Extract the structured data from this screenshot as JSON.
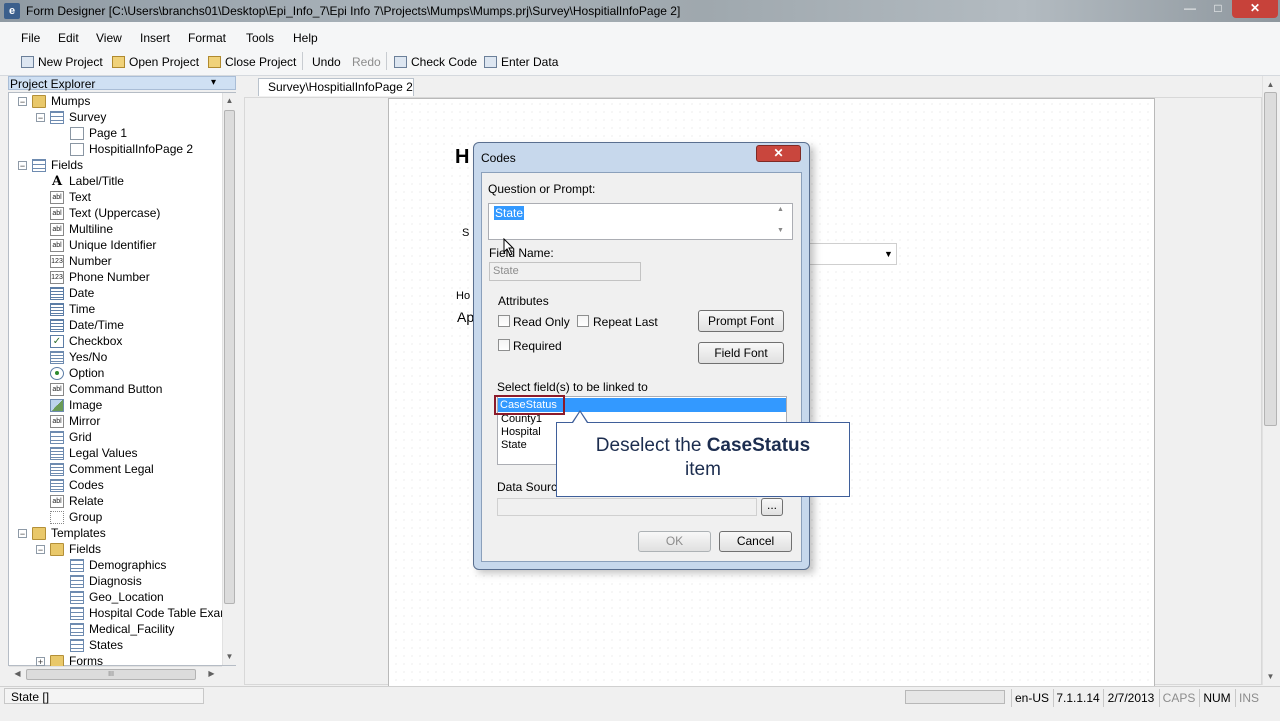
{
  "window": {
    "title": "Form Designer  [C:\\Users\\branchs01\\Desktop\\Epi_Info_7\\Epi Info 7\\Projects\\Mumps\\Mumps.prj\\Survey\\HospitialInfoPage 2]",
    "app_icon": "e",
    "minimize": "—",
    "maximize": "□",
    "close": "✕"
  },
  "menu": [
    "File",
    "Edit",
    "View",
    "Insert",
    "Format",
    "Tools",
    "Help"
  ],
  "toolbar": {
    "new_project": "New Project",
    "open_project": "Open Project",
    "close_project": "Close Project",
    "undo": "Undo",
    "redo": "Redo",
    "check_code": "Check Code",
    "enter_data": "Enter Data"
  },
  "explorer": {
    "title": "Project Explorer",
    "pin": "▾",
    "tree": [
      {
        "label": "Mumps",
        "icon": "folder-icon"
      },
      {
        "label": "Survey",
        "icon": "form-icon"
      },
      {
        "label": "Page 1",
        "icon": "page-icon"
      },
      {
        "label": "HospitialInfoPage 2",
        "icon": "page-icon"
      },
      {
        "label": "Fields",
        "icon": "form-icon"
      },
      {
        "label": "Label/Title",
        "icon": "label-icon"
      },
      {
        "label": "Text",
        "icon": "text-field-icon"
      },
      {
        "label": "Text (Uppercase)",
        "icon": "text-field-icon"
      },
      {
        "label": "Multiline",
        "icon": "text-field-icon"
      },
      {
        "label": "Unique Identifier",
        "icon": "text-field-icon"
      },
      {
        "label": "Number",
        "icon": "number-icon"
      },
      {
        "label": "Phone Number",
        "icon": "number-icon"
      },
      {
        "label": "Date",
        "icon": "calendar-icon"
      },
      {
        "label": "Time",
        "icon": "calendar-icon"
      },
      {
        "label": "Date/Time",
        "icon": "calendar-icon"
      },
      {
        "label": "Checkbox",
        "icon": "checkbox-icon"
      },
      {
        "label": "Yes/No",
        "icon": "yes-no-icon"
      },
      {
        "label": "Option",
        "icon": "option-icon"
      },
      {
        "label": "Command Button",
        "icon": "text-field-icon"
      },
      {
        "label": "Image",
        "icon": "image-icon"
      },
      {
        "label": "Mirror",
        "icon": "text-field-icon"
      },
      {
        "label": "Grid",
        "icon": "grid-icon"
      },
      {
        "label": "Legal Values",
        "icon": "list-icon"
      },
      {
        "label": "Comment Legal",
        "icon": "list-icon"
      },
      {
        "label": "Codes",
        "icon": "list-icon"
      },
      {
        "label": "Relate",
        "icon": "text-field-icon"
      },
      {
        "label": "Group",
        "icon": "group-icon"
      },
      {
        "label": "Templates",
        "icon": "folder-icon"
      },
      {
        "label": "Fields",
        "icon": "folder-icon"
      },
      {
        "label": "Demographics",
        "icon": "form-icon"
      },
      {
        "label": "Diagnosis",
        "icon": "form-icon"
      },
      {
        "label": "Geo_Location",
        "icon": "form-icon"
      },
      {
        "label": "Hospital Code Table Examp",
        "icon": "form-icon"
      },
      {
        "label": "Medical_Facility",
        "icon": "form-icon"
      },
      {
        "label": "States",
        "icon": "form-icon"
      },
      {
        "label": "Forms",
        "icon": "folder-icon"
      }
    ],
    "hscroll_grip": "III"
  },
  "document": {
    "tab": "Survey\\HospitialInfoPage 2",
    "partial_heading": "H",
    "partial_label_1": "S",
    "partial_label_2": "Ho",
    "partial_value": "Ap"
  },
  "dialog": {
    "title": "Codes",
    "close": "✕",
    "question_label": "Question or Prompt:",
    "prompt_value": "State",
    "field_name_label": "Field Name:",
    "field_name_value": "State",
    "attributes_label": "Attributes",
    "read_only": "Read Only",
    "repeat_last": "Repeat Last",
    "required": "Required",
    "prompt_font": "Prompt Font",
    "field_font": "Field Font",
    "link_label": "Select field(s) to be linked to",
    "list_items": [
      "CaseStatus",
      "County1",
      "Hospital",
      "State"
    ],
    "data_source_label": "Data Source",
    "browse": "...",
    "ok": "OK",
    "cancel": "Cancel"
  },
  "callout": {
    "prefix": "Deselect the ",
    "bold": "CaseStatus",
    "suffix": "item"
  },
  "statusbar": {
    "left": "State []",
    "locale": "en-US",
    "version": "7.1.1.14",
    "date": "2/7/2013",
    "caps": "CAPS",
    "num": "NUM",
    "ins": "INS"
  }
}
